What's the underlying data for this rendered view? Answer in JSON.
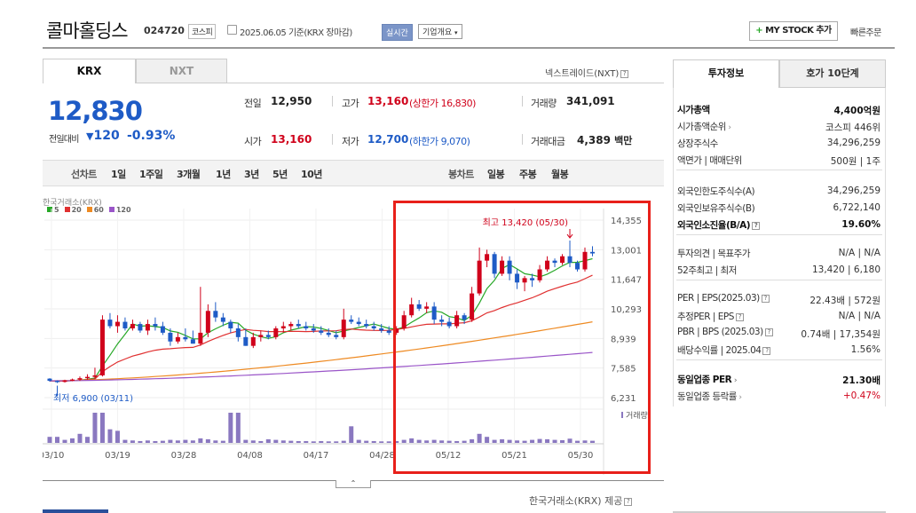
{
  "header": {
    "title": "콜마홀딩스",
    "code": "024720",
    "market_badge": "코스피",
    "date": "2025.06.05",
    "date_suffix": "기준(KRX 장마감)",
    "live_badge": "실시간",
    "company_button": "기업개요",
    "mystock_button": "MY STOCK 추가",
    "quick_order": "빠른주문"
  },
  "market_tabs": {
    "tab1": "KRX",
    "tab2": "NXT",
    "nxt_link": "넥스트레이드(NXT)"
  },
  "price": {
    "current": "12,830",
    "change_label": "전일대비",
    "change_value": "120",
    "change_pct": "-0.93%"
  },
  "stats": {
    "prev_label": "전일",
    "prev": "12,950",
    "high_label": "고가",
    "high": "13,160",
    "upper_label": "(상한가 16,830)",
    "volume_label": "거래량",
    "volume": "341,091",
    "open_label": "시가",
    "open": "13,160",
    "low_label": "저가",
    "low": "12,700",
    "lower_label": "(하한가 9,070)",
    "amount_label": "거래대금",
    "amount": "4,389",
    "amount_unit": "백만"
  },
  "periods": {
    "line_chart": "선차트",
    "p1": "1일",
    "p2": "1주일",
    "p3": "3개월",
    "p4": "1년",
    "p5": "3년",
    "p6": "5년",
    "p7": "10년",
    "candle": "봉차트",
    "daily": "일봉",
    "weekly": "주봉",
    "monthly": "월봉"
  },
  "chart": {
    "source_label": "한국거래소(KRX)",
    "legend": [
      {
        "name": "5",
        "color": "#27a827"
      },
      {
        "name": "20",
        "color": "#e03030"
      },
      {
        "name": "60",
        "color": "#ee8a22"
      },
      {
        "name": "120",
        "color": "#9a55c8"
      }
    ],
    "high_annotation": "최고 13,420 (05/30)",
    "low_annotation": "최저 6,900 (03/11)",
    "volume_label": "거래량",
    "footer_source": "한국거래소(KRX) 제공",
    "accent_red": "#d0021b",
    "accent_blue": "#1e5bc6"
  },
  "chart_data": {
    "type": "candlestick",
    "y_ticks": [
      "14,355",
      "13,001",
      "11,647",
      "10,293",
      "8,939",
      "7,585",
      "6,231"
    ],
    "ylim": [
      6231,
      14355
    ],
    "x_ticks": [
      "03/10",
      "03/19",
      "03/28",
      "04/08",
      "04/17",
      "04/28",
      "05/12",
      "05/21",
      "05/30"
    ],
    "ohlc": [
      [
        7100,
        7120,
        6960,
        7000
      ],
      [
        7000,
        7020,
        6900,
        6950
      ],
      [
        6950,
        7050,
        6920,
        7020
      ],
      [
        7020,
        7100,
        6980,
        7060
      ],
      [
        7060,
        7200,
        7000,
        7120
      ],
      [
        7120,
        7300,
        7050,
        7180
      ],
      [
        7180,
        7600,
        7100,
        7250
      ],
      [
        7250,
        10000,
        7200,
        9800
      ],
      [
        9800,
        10100,
        9400,
        9500
      ],
      [
        9500,
        10000,
        9200,
        9700
      ],
      [
        9700,
        9900,
        9300,
        9400
      ],
      [
        9400,
        9800,
        9300,
        9600
      ],
      [
        9600,
        9700,
        9200,
        9300
      ],
      [
        9300,
        9800,
        9100,
        9600
      ],
      [
        9600,
        9900,
        9300,
        9500
      ],
      [
        9500,
        9700,
        9100,
        9200
      ],
      [
        9200,
        9400,
        8600,
        8800
      ],
      [
        8800,
        9200,
        8700,
        9000
      ],
      [
        9000,
        9400,
        8800,
        8900
      ],
      [
        8900,
        9300,
        8700,
        8700
      ],
      [
        8700,
        11300,
        8600,
        9200
      ],
      [
        9200,
        10500,
        9000,
        10200
      ],
      [
        10200,
        10600,
        9700,
        9900
      ],
      [
        9900,
        10100,
        9500,
        9700
      ],
      [
        9700,
        9800,
        9200,
        9400
      ],
      [
        9400,
        9600,
        8800,
        9000
      ],
      [
        9000,
        9400,
        8600,
        8600
      ],
      [
        8600,
        9200,
        8500,
        9000
      ],
      [
        9000,
        9300,
        8800,
        9100
      ],
      [
        9100,
        9300,
        8900,
        9000
      ],
      [
        9000,
        9500,
        8900,
        9400
      ],
      [
        9400,
        9700,
        9200,
        9500
      ],
      [
        9500,
        9700,
        9300,
        9600
      ],
      [
        9600,
        9800,
        9400,
        9500
      ],
      [
        9500,
        9700,
        9300,
        9400
      ],
      [
        9400,
        9600,
        9200,
        9300
      ],
      [
        9300,
        9500,
        9100,
        9200
      ],
      [
        9200,
        9400,
        9000,
        9100
      ],
      [
        9100,
        9300,
        8900,
        9000
      ],
      [
        9000,
        10300,
        8900,
        9800
      ],
      [
        9800,
        10000,
        9600,
        9700
      ],
      [
        9700,
        9900,
        9500,
        9600
      ],
      [
        9600,
        9800,
        9400,
        9500
      ],
      [
        9500,
        9700,
        9300,
        9400
      ],
      [
        9400,
        9600,
        9200,
        9300
      ],
      [
        9300,
        9500,
        9100,
        9200
      ],
      [
        9200,
        9500,
        9100,
        9400
      ],
      [
        9400,
        10200,
        9300,
        10000
      ],
      [
        10000,
        10800,
        9900,
        10500
      ],
      [
        10500,
        10700,
        10200,
        10300
      ],
      [
        10300,
        10600,
        10100,
        10400
      ],
      [
        10400,
        10600,
        9600,
        9800
      ],
      [
        9800,
        10000,
        9500,
        9700
      ],
      [
        9700,
        9900,
        9400,
        9500
      ],
      [
        9500,
        10200,
        9400,
        10000
      ],
      [
        10000,
        10100,
        9600,
        9800
      ],
      [
        9800,
        11300,
        9700,
        11000
      ],
      [
        11000,
        13100,
        10900,
        12500
      ],
      [
        12500,
        13000,
        12200,
        12800
      ],
      [
        12800,
        12900,
        11700,
        11900
      ],
      [
        11900,
        12700,
        11800,
        12500
      ],
      [
        12500,
        12700,
        11600,
        11900
      ],
      [
        11900,
        12100,
        11200,
        11500
      ],
      [
        11500,
        11800,
        11100,
        11700
      ],
      [
        11700,
        11900,
        11300,
        11600
      ],
      [
        11600,
        12300,
        11500,
        12100
      ],
      [
        12100,
        12700,
        12000,
        12500
      ],
      [
        12500,
        12600,
        12200,
        12400
      ],
      [
        12400,
        12800,
        12300,
        12700
      ],
      [
        12700,
        13420,
        12200,
        12400
      ],
      [
        12400,
        12500,
        12000,
        12100
      ],
      [
        12100,
        13100,
        12000,
        12900
      ],
      [
        12900,
        13160,
        12700,
        12830
      ]
    ],
    "volume_range": [
      0,
      1
    ]
  },
  "info_panel": {
    "tab1": "투자정보",
    "tab2": "호가 10단계",
    "mcap_label": "시가총액",
    "mcap": "4,400억원",
    "mcap_rank_label": "시가총액순위",
    "mcap_rank": "코스피 446위",
    "shares_label": "상장주식수",
    "shares": "34,296,259",
    "par_label": "액면가 | 매매단위",
    "par": "500원 | 1주",
    "foreign_limit_label": "외국인한도주식수(A)",
    "foreign_limit": "34,296,259",
    "foreign_hold_label": "외국인보유주식수(B)",
    "foreign_hold": "6,722,140",
    "foreign_ratio_label": "외국인소진율(B/A)",
    "foreign_ratio": "19.60%",
    "opinion_label": "투자의견 | 목표주가",
    "opinion": "N/A | N/A",
    "w52_label": "52주최고 | 최저",
    "w52": "13,420 | 6,180",
    "per_label": "PER | EPS(2025.03)",
    "per": "22.43배 | 572원",
    "est_label": "추정PER | EPS",
    "est": "N/A | N/A",
    "pbr_label": "PBR | BPS (2025.03)",
    "pbr": "0.74배 | 17,354원",
    "div_label": "배당수익률 | 2025.04",
    "div": "1.56%",
    "sector_per_label": "동일업종 PER",
    "sector_per": "21.30배",
    "sector_rate_label": "동일업종 등락률",
    "sector_rate": "+0.47%"
  }
}
